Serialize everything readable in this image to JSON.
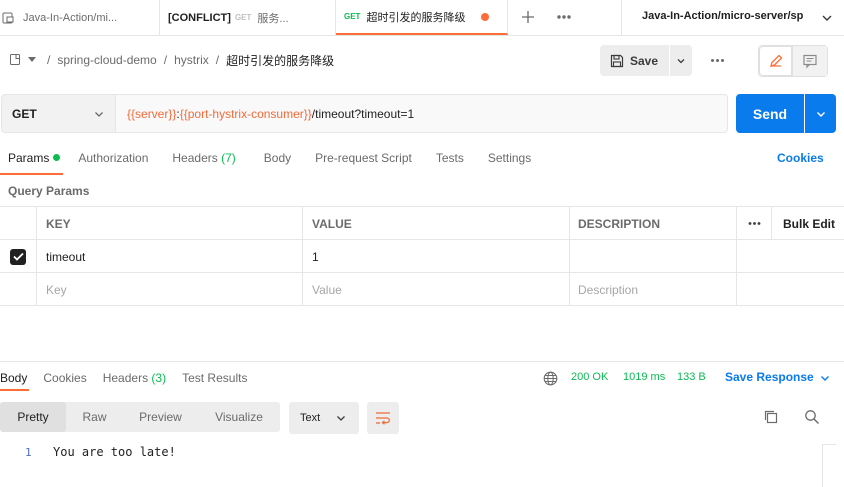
{
  "tabs": [
    {
      "label": "Java-In-Action/mi...",
      "method": "",
      "conflict": ""
    },
    {
      "label": "服务...",
      "method": "GET",
      "conflict": "[CONFLICT]"
    },
    {
      "label": "超时引发的服务降级",
      "method": "GET",
      "conflict": ""
    }
  ],
  "environment": {
    "label": "Java-In-Action/micro-server/sp"
  },
  "breadcrumb": {
    "items": [
      "spring-cloud-demo",
      "hystrix",
      "超时引发的服务降级"
    ],
    "separator": "/"
  },
  "toolbar": {
    "save_label": "Save"
  },
  "request": {
    "method": "GET",
    "url_var_1": "{{server}}",
    "url_colon": ":",
    "url_var_2": "{{port-hystrix-consumer}}",
    "url_path": "/timeout?timeout=1",
    "send_label": "Send"
  },
  "request_tabs": {
    "params": "Params",
    "authorization": "Authorization",
    "headers": "Headers",
    "headers_count": "(7)",
    "body": "Body",
    "prerequest": "Pre-request Script",
    "tests": "Tests",
    "settings": "Settings",
    "cookies": "Cookies"
  },
  "query_params": {
    "title": "Query Params",
    "columns": {
      "key": "KEY",
      "value": "VALUE",
      "description": "DESCRIPTION",
      "bulk_edit": "Bulk Edit"
    },
    "rows": [
      {
        "key": "timeout",
        "value": "1",
        "description": "",
        "checked": true
      }
    ],
    "placeholder": {
      "key": "Key",
      "value": "Value",
      "description": "Description"
    }
  },
  "response_tabs": {
    "body": "Body",
    "cookies": "Cookies",
    "headers": "Headers",
    "headers_count": "(3)",
    "test_results": "Test Results"
  },
  "response_meta": {
    "status": "200 OK",
    "time": "1019 ms",
    "size": "133 B",
    "save_response": "Save Response"
  },
  "view_modes": {
    "pretty": "Pretty",
    "raw": "Raw",
    "preview": "Preview",
    "visualize": "Visualize",
    "format": "Text"
  },
  "response_body": {
    "line_number": "1",
    "text": "You are too late!"
  },
  "colors": {
    "accent": "#ff6c37",
    "primary": "#097bed",
    "success": "#0cbb52",
    "variable": "#f26b3a"
  }
}
